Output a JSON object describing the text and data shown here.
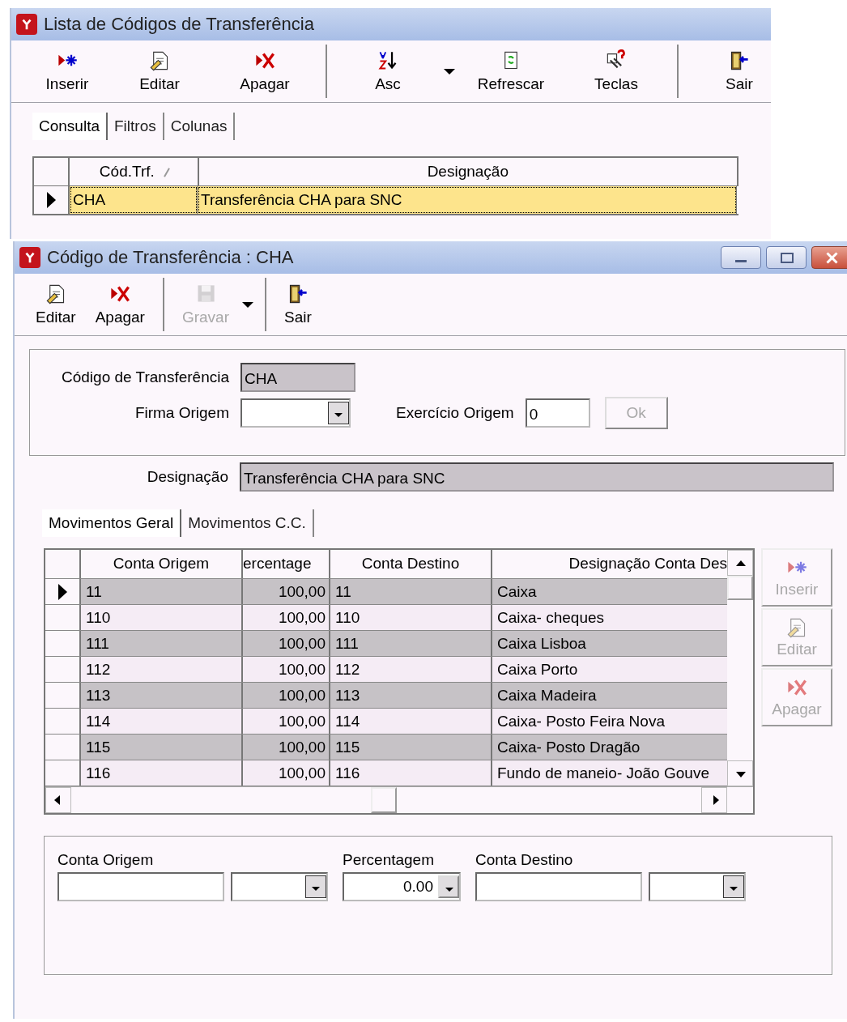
{
  "list_window": {
    "title": "Lista de Códigos de Transferência",
    "toolbar": [
      {
        "label": "Inserir",
        "kind": "insert",
        "disabled": false
      },
      {
        "label": "Editar",
        "kind": "edit",
        "disabled": false
      },
      {
        "label": "Apagar",
        "kind": "delete",
        "disabled": false
      },
      {
        "label": "Asc",
        "kind": "sort",
        "disabled": false,
        "dropdown": true,
        "separator_before": true
      },
      {
        "label": "Refrescar",
        "kind": "refresh",
        "disabled": false
      },
      {
        "label": "Teclas",
        "kind": "keys",
        "disabled": false
      },
      {
        "label": "Sair",
        "kind": "exit",
        "disabled": false,
        "separator_before": true
      }
    ],
    "tabs": [
      {
        "label": "Consulta",
        "selected": true
      },
      {
        "label": "Filtros",
        "selected": false
      },
      {
        "label": "Colunas",
        "selected": false
      }
    ],
    "table": {
      "columns": [
        "Cód.Trf.",
        "Designação"
      ],
      "rows": [
        {
          "cells": [
            "CHA",
            "Transferência CHA para SNC"
          ],
          "selected": true
        }
      ]
    }
  },
  "detail_window": {
    "title": "Código de Transferência : CHA",
    "toolbar": [
      {
        "label": "Editar",
        "kind": "edit",
        "disabled": false
      },
      {
        "label": "Apagar",
        "kind": "delete",
        "disabled": false
      },
      {
        "label": "Gravar",
        "kind": "save",
        "disabled": true,
        "dropdown": true,
        "separator_before": true
      },
      {
        "label": "Sair",
        "kind": "exit",
        "disabled": false,
        "separator_before": true
      }
    ],
    "codigo": {
      "label": "Código de Transferência",
      "value": "CHA"
    },
    "firma": {
      "label": "Firma Origem"
    },
    "exercicio": {
      "label": "Exercício Origem",
      "value": "0"
    },
    "ok_button": {
      "label": "Ok",
      "disabled": true
    },
    "designacao": {
      "label": "Designação",
      "value": "Transferência CHA para SNC"
    },
    "tabs": [
      {
        "label": "Movimentos Geral",
        "selected": true
      },
      {
        "label": "Movimentos C.C.",
        "selected": false
      }
    ],
    "table": {
      "columns": [
        "Conta Origem",
        "ercentage",
        "Conta Destino",
        "Designação Conta Des"
      ],
      "rows": [
        {
          "cells": [
            "11",
            "100,00",
            "11",
            "Caixa"
          ],
          "selected": true
        },
        {
          "cells": [
            "110",
            "100,00",
            "110",
            "Caixa- cheques"
          ],
          "selected": false
        },
        {
          "cells": [
            "111",
            "100,00",
            "111",
            "Caixa Lisboa"
          ],
          "selected": false
        },
        {
          "cells": [
            "112",
            "100,00",
            "112",
            "Caixa Porto"
          ],
          "selected": false
        },
        {
          "cells": [
            "113",
            "100,00",
            "113",
            "Caixa Madeira"
          ],
          "selected": false
        },
        {
          "cells": [
            "114",
            "100,00",
            "114",
            "Caixa- Posto Feira Nova"
          ],
          "selected": false
        },
        {
          "cells": [
            "115",
            "100,00",
            "115",
            "Caixa- Posto Dragão"
          ],
          "selected": false
        },
        {
          "cells": [
            "116",
            "100,00",
            "116",
            "Fundo de maneio- João Gouve"
          ],
          "selected": false
        }
      ]
    },
    "side_buttons": [
      {
        "label": "Inserir",
        "kind": "insert",
        "disabled": true
      },
      {
        "label": "Editar",
        "kind": "edit",
        "disabled": true
      },
      {
        "label": "Apagar",
        "kind": "delete",
        "disabled": true
      }
    ],
    "entry": {
      "conta_origem": {
        "label": "Conta Origem"
      },
      "percentagem": {
        "label": "Percentagem",
        "value": "0.00"
      },
      "conta_destino": {
        "label": "Conta Destino"
      }
    }
  }
}
